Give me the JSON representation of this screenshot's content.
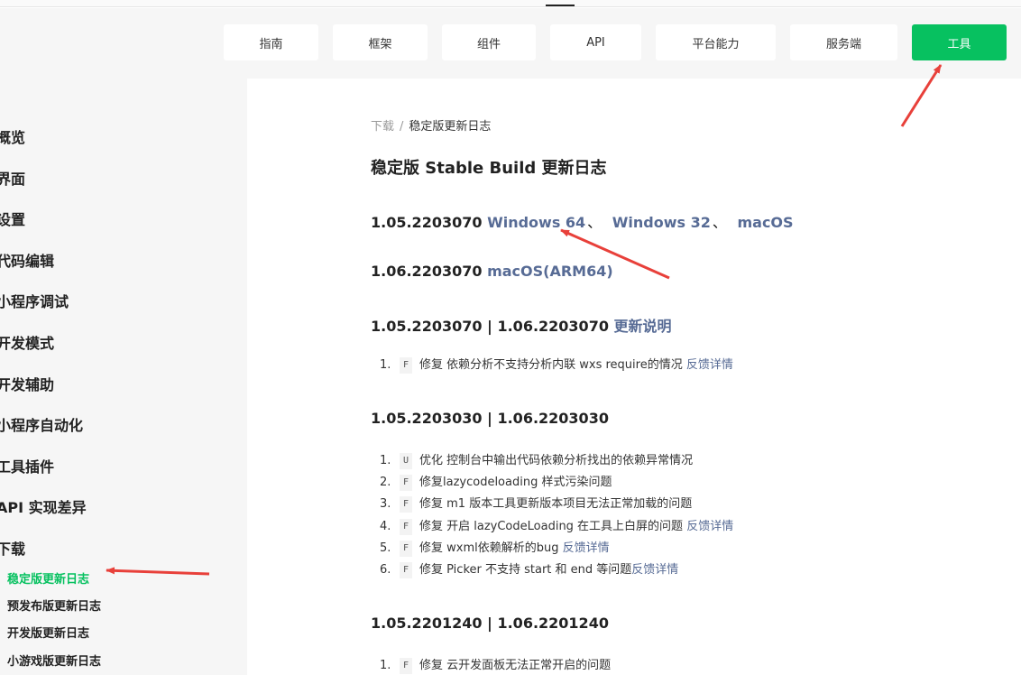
{
  "nav": {
    "items": [
      "指南",
      "框架",
      "组件",
      "API",
      "平台能力",
      "服务端",
      "工具"
    ],
    "active_index": 6,
    "accent_color": "#07c160"
  },
  "sidebar": {
    "items": [
      "概览",
      "界面",
      "设置",
      "代码编辑",
      "小程序调试",
      "开发模式",
      "开发辅助",
      "小程序自动化",
      "工具插件",
      "API 实现差异",
      "下载"
    ],
    "subitems": [
      "稳定版更新日志",
      "预发布版更新日志",
      "开发版更新日志",
      "小游戏版更新日志"
    ],
    "active_sub_index": 0
  },
  "content": {
    "breadcrumb": {
      "parent": "下载",
      "separator": "/",
      "current": "稳定版更新日志"
    },
    "title": "稳定版 Stable Build 更新日志",
    "downloads": [
      {
        "version": "1.05.2203070",
        "links": [
          "Windows 64",
          "Windows 32",
          "macOS"
        ],
        "separator": "、"
      },
      {
        "version": "1.06.2203070",
        "links": [
          "macOS(ARM64)"
        ]
      }
    ],
    "sections": [
      {
        "heading": "1.05.2203070 | 1.06.2203070",
        "heading_link": "更新说明",
        "items": [
          {
            "num": "1.",
            "tag": "F",
            "text": "修复 依赖分析不支持分析内联 wxs require的情况",
            "link": "反馈详情"
          }
        ]
      },
      {
        "heading": "1.05.2203030 | 1.06.2203030",
        "heading_link": "",
        "items": [
          {
            "num": "1.",
            "tag": "U",
            "text": "优化 控制台中输出代码依赖分析找出的依赖异常情况",
            "link": ""
          },
          {
            "num": "2.",
            "tag": "F",
            "text": "修复lazycodeloading 样式污染问题",
            "link": ""
          },
          {
            "num": "3.",
            "tag": "F",
            "text": "修复 m1 版本工具更新版本项目无法正常加载的问题",
            "link": ""
          },
          {
            "num": "4.",
            "tag": "F",
            "text": "修复 开启 lazyCodeLoading 在工具上白屏的问题",
            "link": "反馈详情"
          },
          {
            "num": "5.",
            "tag": "F",
            "text": "修复 wxml依赖解析的bug",
            "link": "反馈详情"
          },
          {
            "num": "6.",
            "tag": "F",
            "text": "修复 Picker 不支持 start 和 end 等问题",
            "link": "反馈详情"
          }
        ]
      },
      {
        "heading": "1.05.2201240 | 1.06.2201240",
        "heading_link": "",
        "items": [
          {
            "num": "1.",
            "tag": "F",
            "text": "修复 云开发面板无法正常开启的问题",
            "link": ""
          }
        ]
      }
    ]
  },
  "annotation_color": "#e8403a"
}
